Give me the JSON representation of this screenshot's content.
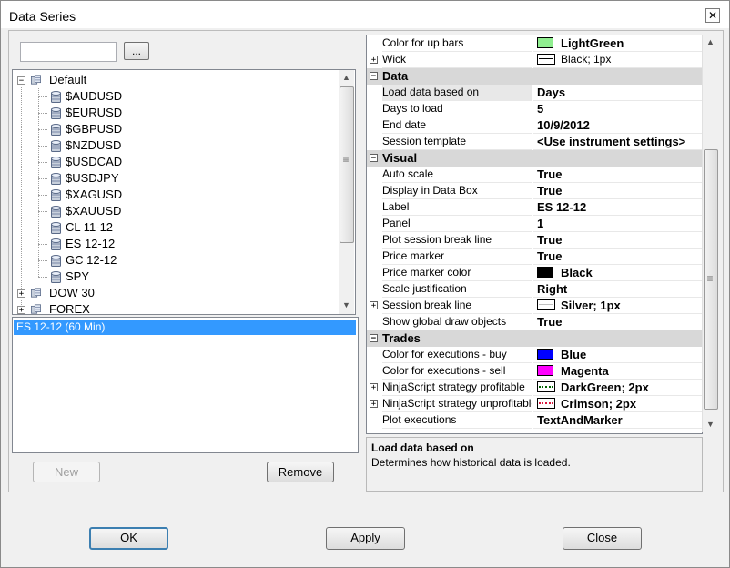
{
  "window": {
    "title": "Data Series",
    "close_glyph": "✕"
  },
  "instrument_search": {
    "value": "",
    "browse_label": "..."
  },
  "tree": {
    "groups": [
      {
        "label": "Default",
        "expanded": true,
        "expander": "−",
        "items": [
          "$AUDUSD",
          "$EURUSD",
          "$GBPUSD",
          "$NZDUSD",
          "$USDCAD",
          "$USDJPY",
          "$XAGUSD",
          "$XAUUSD",
          "CL 11-12",
          "ES 12-12",
          "GC 12-12",
          "SPY"
        ]
      },
      {
        "label": "DOW 30",
        "expanded": false,
        "expander": "+"
      },
      {
        "label": "FOREX",
        "expanded": false,
        "expander": "+"
      }
    ]
  },
  "series_list": {
    "items": [
      "ES 12-12 (60 Min)"
    ]
  },
  "left_buttons": {
    "new": "New",
    "remove": "Remove"
  },
  "properties": {
    "rows": [
      {
        "kind": "prop",
        "name": "Color for up bars",
        "value": "LightGreen",
        "swatch": "#90ee90"
      },
      {
        "kind": "prop",
        "name": "Wick",
        "value": "Black; 1px",
        "pen": "#000000",
        "pen_style": "solid",
        "expandable": true,
        "plain": true
      },
      {
        "kind": "cat",
        "name": "Data"
      },
      {
        "kind": "prop",
        "name": "Load data based on",
        "value": "Days",
        "selected": true
      },
      {
        "kind": "prop",
        "name": "Days to load",
        "value": "5"
      },
      {
        "kind": "prop",
        "name": "End date",
        "value": "10/9/2012"
      },
      {
        "kind": "prop",
        "name": "Session template",
        "value": "<Use instrument settings>"
      },
      {
        "kind": "cat",
        "name": "Visual"
      },
      {
        "kind": "prop",
        "name": "Auto scale",
        "value": "True"
      },
      {
        "kind": "prop",
        "name": "Display in Data Box",
        "value": "True"
      },
      {
        "kind": "prop",
        "name": "Label",
        "value": "ES 12-12"
      },
      {
        "kind": "prop",
        "name": "Panel",
        "value": "1"
      },
      {
        "kind": "prop",
        "name": "Plot session break line",
        "value": "True"
      },
      {
        "kind": "prop",
        "name": "Price marker",
        "value": "True"
      },
      {
        "kind": "prop",
        "name": "Price marker color",
        "value": "Black",
        "swatch": "#000000"
      },
      {
        "kind": "prop",
        "name": "Scale justification",
        "value": "Right"
      },
      {
        "kind": "prop",
        "name": "Session break line",
        "value": "Silver; 1px",
        "pen": "#c0c0c0",
        "pen_style": "solid",
        "expandable": true
      },
      {
        "kind": "prop",
        "name": "Show global draw objects",
        "value": "True"
      },
      {
        "kind": "cat",
        "name": "Trades"
      },
      {
        "kind": "prop",
        "name": "Color for executions - buy",
        "value": "Blue",
        "swatch": "#0000ff"
      },
      {
        "kind": "prop",
        "name": "Color for executions - sell",
        "value": "Magenta",
        "swatch": "#ff00ff"
      },
      {
        "kind": "prop",
        "name": "NinjaScript strategy profitable",
        "value": "DarkGreen; 2px",
        "pen": "#006400",
        "pen_style": "dotted",
        "expandable": true
      },
      {
        "kind": "prop",
        "name": "NinjaScript strategy unprofitable",
        "value": "Crimson; 2px",
        "pen": "#dc143c",
        "pen_style": "dotted",
        "expandable": true
      },
      {
        "kind": "prop",
        "name": "Plot executions",
        "value": "TextAndMarker"
      }
    ]
  },
  "help": {
    "title": "Load data based on",
    "description": "Determines how historical data is loaded."
  },
  "footer_buttons": {
    "ok": "OK",
    "apply": "Apply",
    "close": "Close"
  },
  "icons": {
    "expander_collapse": "minus-box-icon",
    "expander_expand": "plus-box-icon",
    "instrument": "database-icon",
    "scroll_up": "▲",
    "scroll_down": "▼",
    "grip": "≡"
  }
}
